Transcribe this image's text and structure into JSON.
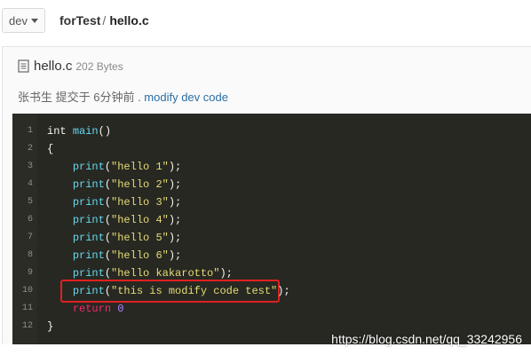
{
  "topbar": {
    "branch": "dev",
    "breadcrumb_repo": "forTest",
    "breadcrumb_sep": "/",
    "breadcrumb_file": "hello.c"
  },
  "file": {
    "name": "hello.c",
    "size": "202 Bytes",
    "icon": "document-icon"
  },
  "commit": {
    "prefix": "张书生 提交于 6分钟前 . ",
    "message": "modify dev code"
  },
  "code": {
    "lines": [
      {
        "n": "1",
        "t": [
          {
            "c": "",
            "v": "int "
          },
          {
            "c": "fn",
            "v": "main"
          },
          {
            "c": "",
            "v": "()"
          }
        ]
      },
      {
        "n": "2",
        "t": [
          {
            "c": "",
            "v": "{"
          }
        ]
      },
      {
        "n": "3",
        "t": [
          {
            "c": "",
            "v": "    "
          },
          {
            "c": "fn",
            "v": "print"
          },
          {
            "c": "",
            "v": "("
          },
          {
            "c": "str",
            "v": "\"hello 1\""
          },
          {
            "c": "",
            "v": ");"
          }
        ]
      },
      {
        "n": "4",
        "t": [
          {
            "c": "",
            "v": "    "
          },
          {
            "c": "fn",
            "v": "print"
          },
          {
            "c": "",
            "v": "("
          },
          {
            "c": "str",
            "v": "\"hello 2\""
          },
          {
            "c": "",
            "v": ");"
          }
        ]
      },
      {
        "n": "5",
        "t": [
          {
            "c": "",
            "v": "    "
          },
          {
            "c": "fn",
            "v": "print"
          },
          {
            "c": "",
            "v": "("
          },
          {
            "c": "str",
            "v": "\"hello 3\""
          },
          {
            "c": "",
            "v": ");"
          }
        ]
      },
      {
        "n": "6",
        "t": [
          {
            "c": "",
            "v": "    "
          },
          {
            "c": "fn",
            "v": "print"
          },
          {
            "c": "",
            "v": "("
          },
          {
            "c": "str",
            "v": "\"hello 4\""
          },
          {
            "c": "",
            "v": ");"
          }
        ]
      },
      {
        "n": "7",
        "t": [
          {
            "c": "",
            "v": "    "
          },
          {
            "c": "fn",
            "v": "print"
          },
          {
            "c": "",
            "v": "("
          },
          {
            "c": "str",
            "v": "\"hello 5\""
          },
          {
            "c": "",
            "v": ");"
          }
        ]
      },
      {
        "n": "8",
        "t": [
          {
            "c": "",
            "v": "    "
          },
          {
            "c": "fn",
            "v": "print"
          },
          {
            "c": "",
            "v": "("
          },
          {
            "c": "str",
            "v": "\"hello 6\""
          },
          {
            "c": "",
            "v": ");"
          }
        ]
      },
      {
        "n": "9",
        "t": [
          {
            "c": "",
            "v": "    "
          },
          {
            "c": "fn",
            "v": "print"
          },
          {
            "c": "",
            "v": "("
          },
          {
            "c": "str",
            "v": "\"hello kakarotto\""
          },
          {
            "c": "",
            "v": ");"
          }
        ]
      },
      {
        "n": "10",
        "t": [
          {
            "c": "",
            "v": "    "
          },
          {
            "c": "fn",
            "v": "print"
          },
          {
            "c": "",
            "v": "("
          },
          {
            "c": "str",
            "v": "\"this is modify code test\""
          },
          {
            "c": "",
            "v": ");"
          }
        ]
      },
      {
        "n": "11",
        "t": [
          {
            "c": "",
            "v": "    "
          },
          {
            "c": "kw",
            "v": "return"
          },
          {
            "c": "",
            "v": " "
          },
          {
            "c": "num",
            "v": "0"
          }
        ]
      },
      {
        "n": "12",
        "t": [
          {
            "c": "",
            "v": "}"
          }
        ]
      }
    ],
    "highlighted_line": "10"
  },
  "colors": {
    "code_bg": "#272822",
    "function": "#66d9ef",
    "string": "#e6db74",
    "keyword": "#f92672",
    "number": "#ae81ff",
    "highlight_border": "#e02020",
    "link": "#2b6ea5"
  },
  "watermark": "https://blog.csdn.net/qq_33242956"
}
